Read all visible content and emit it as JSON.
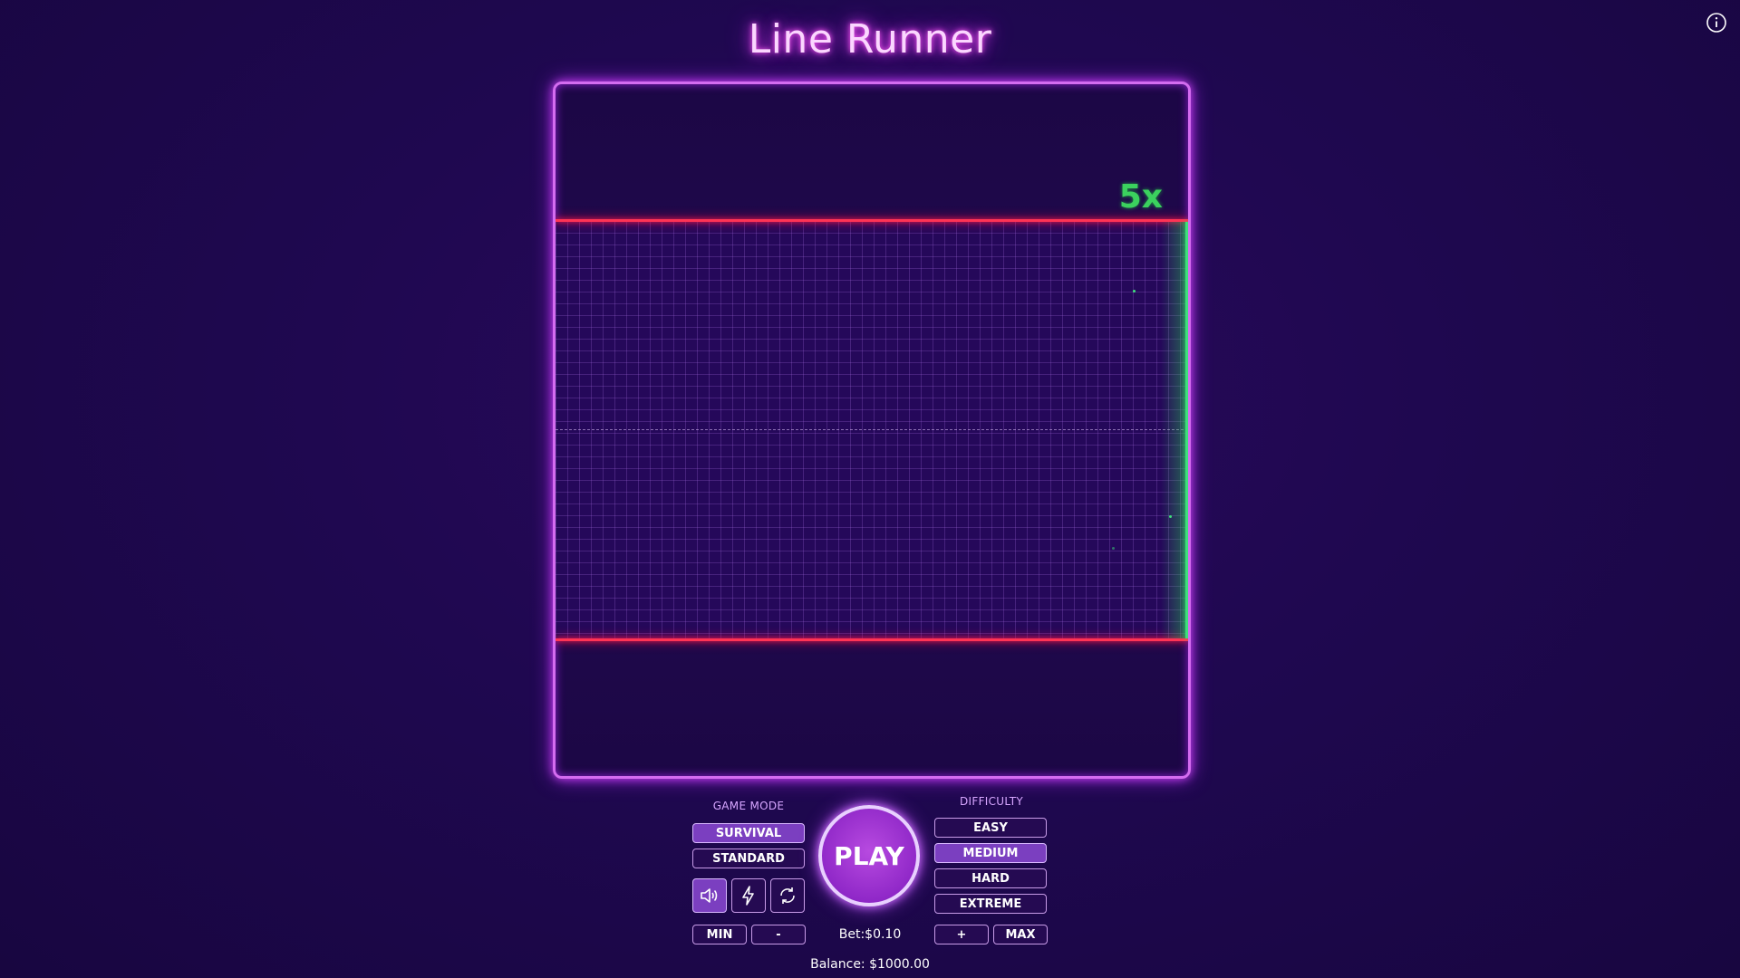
{
  "header": {
    "title": "Line Runner",
    "info_icon": "info-icon"
  },
  "board": {
    "multiplier": "5x",
    "progress_fraction": 1.0
  },
  "game_mode": {
    "label": "GAME MODE",
    "options": [
      "SURVIVAL",
      "STANDARD"
    ],
    "selected": "SURVIVAL"
  },
  "controls": {
    "icons": [
      "speaker-icon",
      "lightning-icon",
      "refresh-icon"
    ],
    "play_label": "PLAY",
    "min_label": "MIN",
    "minus_label": "-",
    "plus_label": "+",
    "max_label": "MAX",
    "bet_text": "Bet:$0.10",
    "balance_text": "Balance: $1000.00"
  },
  "difficulty": {
    "label": "DIFFICULTY",
    "options": [
      "EASY",
      "MEDIUM",
      "HARD",
      "EXTREME"
    ],
    "selected": "MEDIUM"
  },
  "colors": {
    "boundary": "#ff3355",
    "goal": "#3de07a",
    "frame": "#d46cf0",
    "accent": "#9028c8"
  }
}
